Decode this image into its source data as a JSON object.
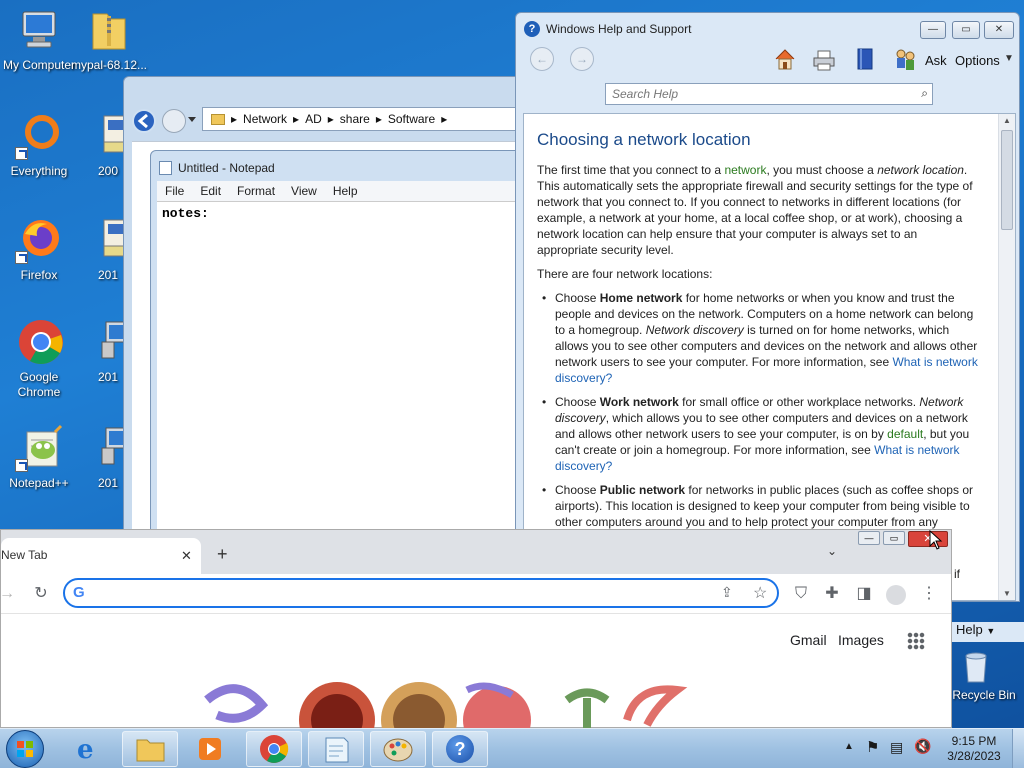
{
  "desktop": {
    "icons": [
      {
        "label": "My Computer"
      },
      {
        "label": "mypal-68.12..."
      },
      {
        "label": "Everything"
      },
      {
        "label": "200"
      },
      {
        "label": "Firefox"
      },
      {
        "label": "201"
      },
      {
        "label": "Google Chrome"
      },
      {
        "label": "201"
      },
      {
        "label": "Notepad++"
      },
      {
        "label": "201"
      },
      {
        "label": "Recycle Bin"
      }
    ]
  },
  "explorer": {
    "breadcrumb": [
      "Network",
      "AD",
      "share",
      "Software"
    ]
  },
  "notepad": {
    "title": "Untitled - Notepad",
    "menu": [
      "File",
      "Edit",
      "Format",
      "View",
      "Help"
    ],
    "text": "notes:"
  },
  "help": {
    "title": "Windows Help and Support",
    "ask": "Ask",
    "options": "Options",
    "search_placeholder": "Search Help",
    "heading": "Choosing a network location",
    "p1": {
      "a": "The first time that you connect to a ",
      "network": "network",
      "b": ", you must choose a ",
      "netloc": "network location",
      "c": ". This automatically sets the appropriate firewall and security settings for the type of network that you connect to. If you connect to networks in different locations (for example, a network at your home, at a local coffee shop, or at work), choosing a network location can help ensure that your computer is always set to an appropriate security level."
    },
    "p2": "There are four network locations:",
    "home": {
      "pre": "Choose ",
      "bold": "Home network",
      "a": " for home networks or when you know and trust the people and devices on the network. Computers on a home network can belong to a homegroup. ",
      "italic": "Network discovery",
      "b": " is turned on for home networks, which allows you to see other computers and devices on the network and allows other network users to see your computer. For more information, see ",
      "link": "What is network discovery?"
    },
    "work": {
      "pre": "Choose ",
      "bold": "Work network",
      "a": " for small office or other workplace networks. ",
      "italic": "Network discovery",
      "b": ", which allows you to see other computers and devices on a network and allows other network users to see your computer, is on by ",
      "default": "default",
      "c": ", but you can't create or join a homegroup. For more information, see ",
      "link": "What is network discovery?"
    },
    "public": {
      "pre": "Choose ",
      "bold": "Public network",
      "a": " for networks in public places (such as coffee shops or airports). This location is designed to keep your computer from being visible to other computers around you and to help protect your computer from any"
    },
    "peek_right": "if",
    "peek_help": "Help"
  },
  "chrome": {
    "tab_label": "New Tab",
    "gmail": "Gmail",
    "images": "Images"
  },
  "taskbar": {
    "time": "9:15 PM",
    "date": "3/28/2023"
  },
  "colors": {
    "desktop": "#1f7fd4",
    "help_heading": "#1b4a8a",
    "link": "#1e63b5",
    "glossary": "#2a7a1e",
    "omnibox_border": "#1a73e8",
    "close_red": "#d9443b"
  }
}
